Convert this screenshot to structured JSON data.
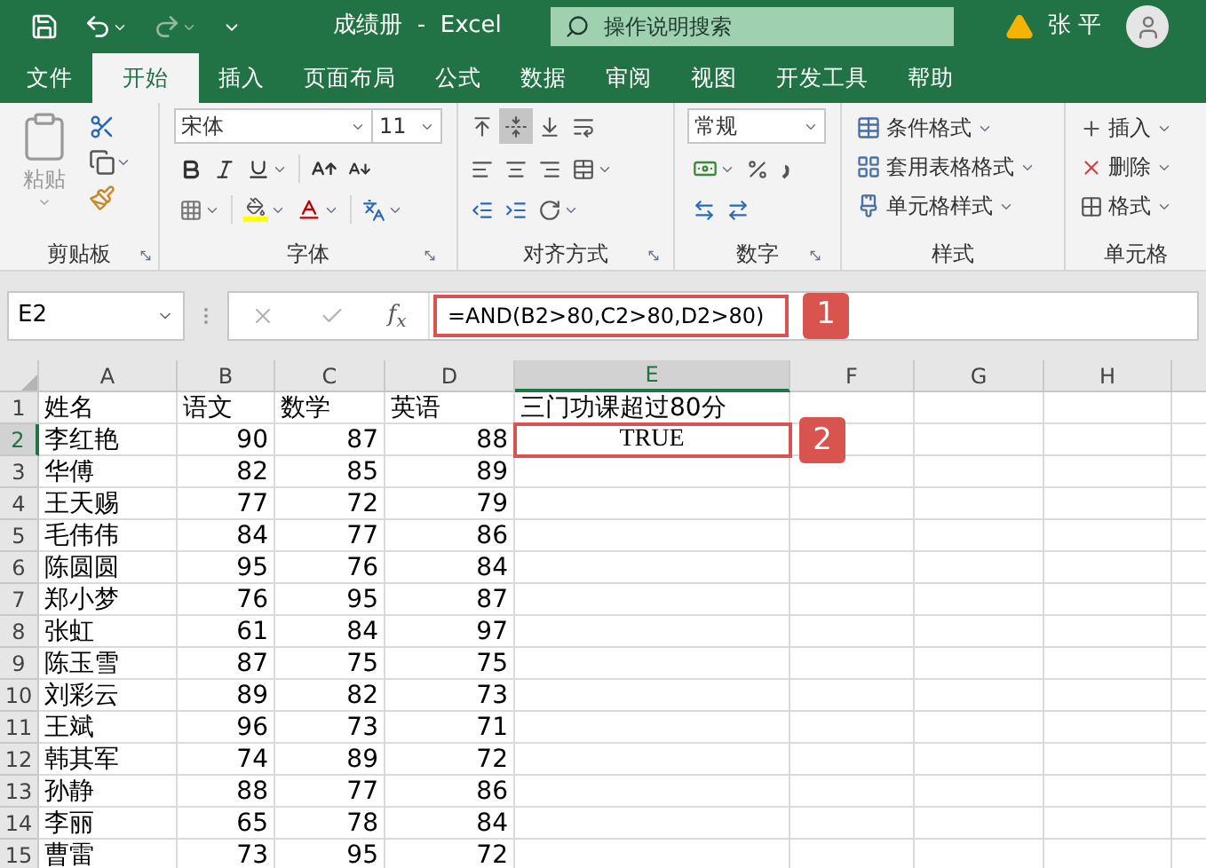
{
  "title_bar": {
    "title": "成绩册  -  Excel",
    "search_placeholder": "操作说明搜索",
    "user": "张 平"
  },
  "tabs": [
    {
      "label": "文件",
      "selected": false
    },
    {
      "label": "开始",
      "selected": true
    },
    {
      "label": "插入",
      "selected": false
    },
    {
      "label": "页面布局",
      "selected": false
    },
    {
      "label": "公式",
      "selected": false
    },
    {
      "label": "数据",
      "selected": false
    },
    {
      "label": "审阅",
      "selected": false
    },
    {
      "label": "视图",
      "selected": false
    },
    {
      "label": "开发工具",
      "selected": false
    },
    {
      "label": "帮助",
      "selected": false
    }
  ],
  "ribbon": {
    "clipboard": {
      "paste": "粘贴",
      "label": "剪贴板"
    },
    "font": {
      "font_name": "宋体",
      "font_size": "11",
      "label": "字体"
    },
    "alignment": {
      "vertical_align": [
        {
          "selected": false
        },
        {
          "selected": true
        },
        {
          "selected": false
        }
      ],
      "label": "对齐方式"
    },
    "number": {
      "format": "常规",
      "label": "数字"
    },
    "styles": {
      "items": [
        "条件格式",
        "套用表格格式",
        "单元格样式"
      ],
      "label": "样式"
    },
    "cells": {
      "items": [
        "插入",
        "删除",
        "格式"
      ],
      "label": "单元格"
    }
  },
  "formula_bar": {
    "name_box": "E2",
    "function_label": "f$_{x}$",
    "formula": "=AND(B2>80,C2>80,D2>80)",
    "highlighted": true,
    "callout": "1"
  },
  "sheet": {
    "columns": [
      {
        "label": "A",
        "selected": false
      },
      {
        "label": "B",
        "selected": false
      },
      {
        "label": "C",
        "selected": false
      },
      {
        "label": "D",
        "selected": false
      },
      {
        "label": "E",
        "selected": true
      },
      {
        "label": "F",
        "selected": false
      },
      {
        "label": "G",
        "selected": false
      },
      {
        "label": "H",
        "selected": false
      }
    ],
    "rows": [
      {
        "number": "1",
        "selected": false,
        "cells": [
          {
            "text": "姓名",
            "kind": "text"
          },
          {
            "text": "语文",
            "kind": "text"
          },
          {
            "text": "数学",
            "kind": "text"
          },
          {
            "text": "英语",
            "kind": "text"
          },
          {
            "text": "三门功课超过80分",
            "kind": "text"
          }
        ]
      },
      {
        "number": "2",
        "selected": true,
        "cells": [
          {
            "text": "李红艳",
            "kind": "text"
          },
          {
            "text": "90",
            "kind": "number"
          },
          {
            "text": "87",
            "kind": "number"
          },
          {
            "text": "88",
            "kind": "number"
          },
          {
            "text": "TRUE",
            "kind": "boolean",
            "callout": "2"
          }
        ]
      },
      {
        "number": "3",
        "selected": false,
        "cells": [
          {
            "text": "华傅",
            "kind": "text"
          },
          {
            "text": "82",
            "kind": "number"
          },
          {
            "text": "85",
            "kind": "number"
          },
          {
            "text": "89",
            "kind": "number"
          }
        ]
      },
      {
        "number": "4",
        "selected": false,
        "cells": [
          {
            "text": "王天赐",
            "kind": "text"
          },
          {
            "text": "77",
            "kind": "number"
          },
          {
            "text": "72",
            "kind": "number"
          },
          {
            "text": "79",
            "kind": "number"
          }
        ]
      },
      {
        "number": "5",
        "selected": false,
        "cells": [
          {
            "text": "毛伟伟",
            "kind": "text"
          },
          {
            "text": "84",
            "kind": "number"
          },
          {
            "text": "77",
            "kind": "number"
          },
          {
            "text": "86",
            "kind": "number"
          }
        ]
      },
      {
        "number": "6",
        "selected": false,
        "cells": [
          {
            "text": "陈圆圆",
            "kind": "text"
          },
          {
            "text": "95",
            "kind": "number"
          },
          {
            "text": "76",
            "kind": "number"
          },
          {
            "text": "84",
            "kind": "number"
          }
        ]
      },
      {
        "number": "7",
        "selected": false,
        "cells": [
          {
            "text": "郑小梦",
            "kind": "text"
          },
          {
            "text": "76",
            "kind": "number"
          },
          {
            "text": "95",
            "kind": "number"
          },
          {
            "text": "87",
            "kind": "number"
          }
        ]
      },
      {
        "number": "8",
        "selected": false,
        "cells": [
          {
            "text": "张虹",
            "kind": "text"
          },
          {
            "text": "61",
            "kind": "number"
          },
          {
            "text": "84",
            "kind": "number"
          },
          {
            "text": "97",
            "kind": "number"
          }
        ]
      },
      {
        "number": "9",
        "selected": false,
        "cells": [
          {
            "text": "陈玉雪",
            "kind": "text"
          },
          {
            "text": "87",
            "kind": "number"
          },
          {
            "text": "75",
            "kind": "number"
          },
          {
            "text": "75",
            "kind": "number"
          }
        ]
      },
      {
        "number": "10",
        "selected": false,
        "cells": [
          {
            "text": "刘彩云",
            "kind": "text"
          },
          {
            "text": "89",
            "kind": "number"
          },
          {
            "text": "82",
            "kind": "number"
          },
          {
            "text": "73",
            "kind": "number"
          }
        ]
      },
      {
        "number": "11",
        "selected": false,
        "cells": [
          {
            "text": "王斌",
            "kind": "text"
          },
          {
            "text": "96",
            "kind": "number"
          },
          {
            "text": "73",
            "kind": "number"
          },
          {
            "text": "71",
            "kind": "number"
          }
        ]
      },
      {
        "number": "12",
        "selected": false,
        "cells": [
          {
            "text": "韩其军",
            "kind": "text"
          },
          {
            "text": "74",
            "kind": "number"
          },
          {
            "text": "89",
            "kind": "number"
          },
          {
            "text": "72",
            "kind": "number"
          }
        ]
      },
      {
        "number": "13",
        "selected": false,
        "cells": [
          {
            "text": "孙静",
            "kind": "text"
          },
          {
            "text": "88",
            "kind": "number"
          },
          {
            "text": "77",
            "kind": "number"
          },
          {
            "text": "86",
            "kind": "number"
          }
        ]
      },
      {
        "number": "14",
        "selected": false,
        "cells": [
          {
            "text": "李丽",
            "kind": "text"
          },
          {
            "text": "65",
            "kind": "number"
          },
          {
            "text": "78",
            "kind": "number"
          },
          {
            "text": "84",
            "kind": "number"
          }
        ]
      },
      {
        "number": "15",
        "selected": false,
        "cells": [
          {
            "text": "曹雷",
            "kind": "text"
          },
          {
            "text": "73",
            "kind": "number"
          },
          {
            "text": "95",
            "kind": "number"
          },
          {
            "text": "72",
            "kind": "number"
          }
        ]
      }
    ]
  }
}
